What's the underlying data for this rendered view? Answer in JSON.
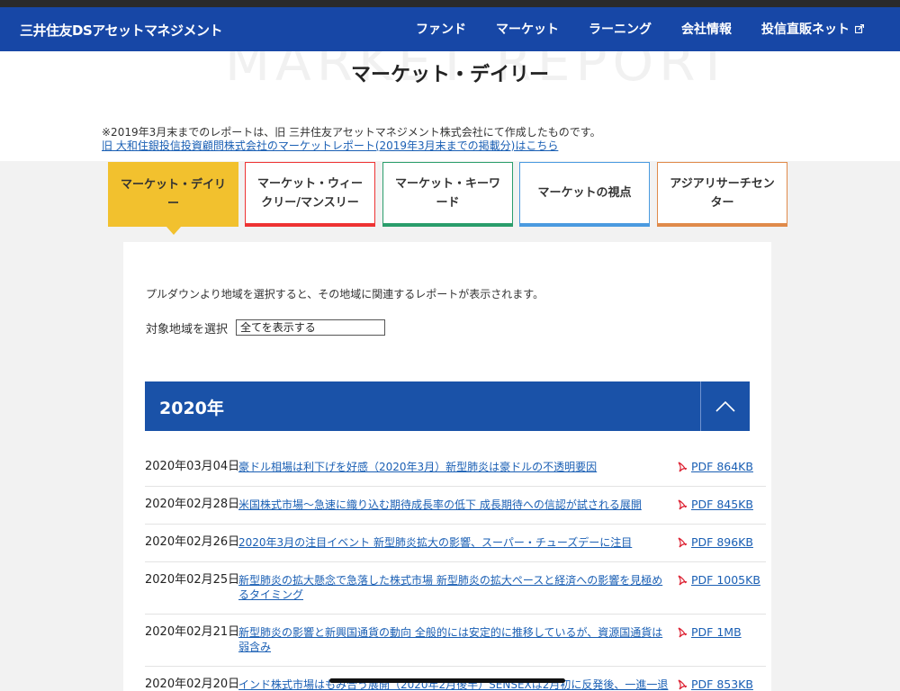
{
  "header": {
    "logo": "三井住友DSアセットマネジメント",
    "nav": [
      {
        "label": "ファンド"
      },
      {
        "label": "マーケット"
      },
      {
        "label": "ラーニング"
      },
      {
        "label": "会社情報"
      },
      {
        "label": "投信直販ネット"
      }
    ]
  },
  "hero": {
    "bg_text": "MARKET REPORT",
    "title": "マーケット・デイリー"
  },
  "notice": {
    "text": "※2019年3月末までのレポートは、旧 三井住友アセットマネジメント株式会社にて作成したものです。",
    "link": "旧 大和住銀投信投資顧問株式会社のマーケットレポート(2019年3月末までの掲載分)はこちら"
  },
  "tabs": [
    {
      "label": "マーケット・デイリー",
      "active": true
    },
    {
      "label": "マーケット・ウィークリー/マンスリー"
    },
    {
      "label": "マーケット・キーワード"
    },
    {
      "label": "マーケットの視点"
    },
    {
      "label": "アジアリサーチセンター"
    }
  ],
  "filter": {
    "instruction": "プルダウンより地域を選択すると、その地域に関連するレポートが表示されます。",
    "label": "対象地域を選択",
    "selected": "全てを表示する"
  },
  "year_section": {
    "year": "2020年"
  },
  "reports": [
    {
      "date": "2020年03月04日",
      "title": "豪ドル相場は利下げを好感（2020年3月）新型肺炎は豪ドルの不透明要因",
      "pdf": "PDF 864KB"
    },
    {
      "date": "2020年02月28日",
      "title": "米国株式市場～急速に織り込む期待成長率の低下 成長期待への信認が試される展開",
      "pdf": "PDF 845KB"
    },
    {
      "date": "2020年02月26日",
      "title": "2020年3月の注目イベント 新型肺炎拡大の影響、スーパー・チューズデーに注目",
      "pdf": "PDF 896KB"
    },
    {
      "date": "2020年02月25日",
      "title": "新型肺炎の拡大懸念で急落した株式市場 新型肺炎の拡大ペースと経済への影響を見極めるタイミング",
      "pdf": "PDF 1005KB"
    },
    {
      "date": "2020年02月21日",
      "title": "新型肺炎の影響と新興国通貨の動向 全般的には安定的に推移しているが、資源国通貨は弱含み",
      "pdf": "PDF 1MB"
    },
    {
      "date": "2020年02月20日",
      "title": "インド株式市場はもみ合う展開（2020年2月後半）SENSEXは2月初に反発後、一進一退",
      "pdf": "PDF 853KB"
    }
  ]
}
